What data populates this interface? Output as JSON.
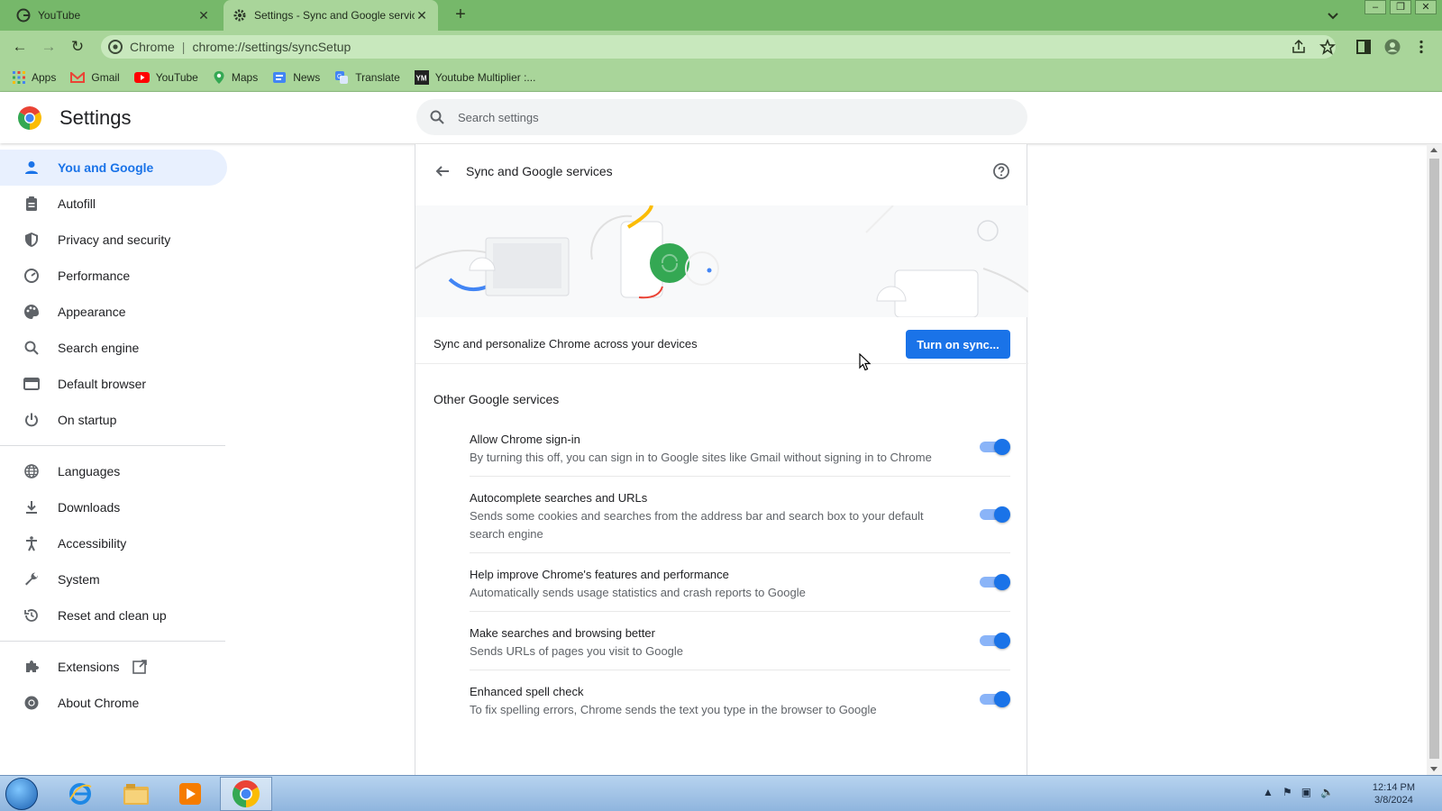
{
  "browser": {
    "tabs": [
      {
        "title": "YouTube",
        "active": false
      },
      {
        "title": "Settings - Sync and Google services",
        "active": true
      }
    ],
    "omnibox": {
      "site_label": "Chrome",
      "url": "chrome://settings/syncSetup"
    },
    "bookmarks": [
      {
        "label": "Apps",
        "icon": "apps-grid-icon"
      },
      {
        "label": "Gmail",
        "icon": "gmail-icon"
      },
      {
        "label": "YouTube",
        "icon": "youtube-icon"
      },
      {
        "label": "Maps",
        "icon": "maps-icon"
      },
      {
        "label": "News",
        "icon": "news-icon"
      },
      {
        "label": "Translate",
        "icon": "translate-icon"
      },
      {
        "label": "Youtube Multiplier :...",
        "icon": "ym-icon"
      }
    ],
    "theme_colors": {
      "tab_strip": "#76b86a",
      "toolbar": "#a9d59a"
    }
  },
  "settings": {
    "title": "Settings",
    "search_placeholder": "Search settings",
    "nav": [
      {
        "label": "You and Google",
        "icon": "person-icon",
        "selected": true
      },
      {
        "label": "Autofill",
        "icon": "clipboard-icon"
      },
      {
        "label": "Privacy and security",
        "icon": "shield-icon"
      },
      {
        "label": "Performance",
        "icon": "speedometer-icon"
      },
      {
        "label": "Appearance",
        "icon": "palette-icon"
      },
      {
        "label": "Search engine",
        "icon": "search-icon"
      },
      {
        "label": "Default browser",
        "icon": "browser-window-icon"
      },
      {
        "label": "On startup",
        "icon": "power-icon"
      },
      {
        "label": "Languages",
        "icon": "globe-icon"
      },
      {
        "label": "Downloads",
        "icon": "download-icon"
      },
      {
        "label": "Accessibility",
        "icon": "accessibility-icon"
      },
      {
        "label": "System",
        "icon": "wrench-icon"
      },
      {
        "label": "Reset and clean up",
        "icon": "history-icon"
      },
      {
        "label": "Extensions",
        "icon": "puzzle-icon"
      },
      {
        "label": "About Chrome",
        "icon": "chrome-icon"
      }
    ],
    "page": {
      "title": "Sync and Google services",
      "sync_text": "Sync and personalize Chrome across your devices",
      "sync_button": "Turn on sync...",
      "other_services_title": "Other Google services",
      "services": [
        {
          "title": "Allow Chrome sign-in",
          "desc": "By turning this off, you can sign in to Google sites like Gmail without signing in to Chrome",
          "enabled": true
        },
        {
          "title": "Autocomplete searches and URLs",
          "desc": "Sends some cookies and searches from the address bar and search box to your default search engine",
          "enabled": true
        },
        {
          "title": "Help improve Chrome's features and performance",
          "desc": "Automatically sends usage statistics and crash reports to Google",
          "enabled": true
        },
        {
          "title": "Make searches and browsing better",
          "desc": "Sends URLs of pages you visit to Google",
          "enabled": true
        },
        {
          "title": "Enhanced spell check",
          "desc": "To fix spelling errors, Chrome sends the text you type in the browser to Google",
          "enabled": true
        }
      ]
    },
    "accent_color": "#1a73e8"
  },
  "taskbar": {
    "time": "12:14 PM",
    "date": "3/8/2024",
    "apps": [
      "internet-explorer-icon",
      "file-explorer-icon",
      "media-player-icon",
      "chrome-icon"
    ]
  }
}
